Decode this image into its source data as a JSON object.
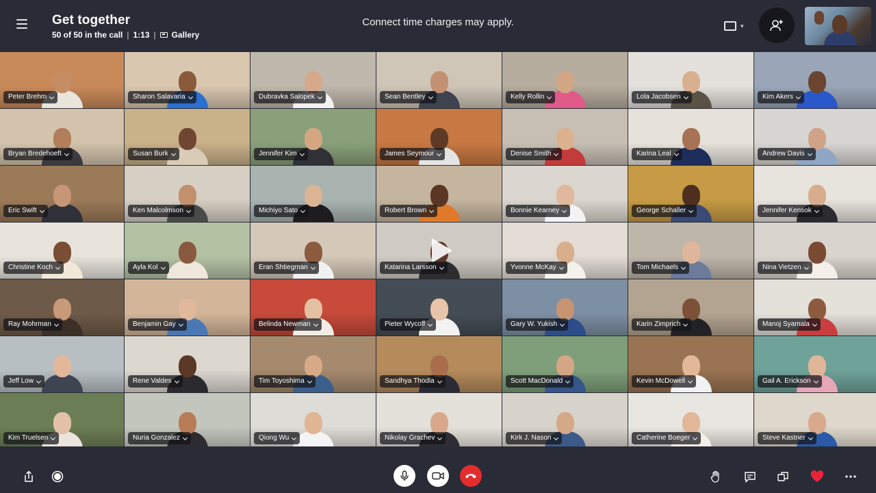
{
  "header": {
    "title": "Get together",
    "participants": "50 of 50 in the call",
    "duration": "1:13",
    "view_mode": "Gallery",
    "notice": "Connect time charges may apply."
  },
  "participants": [
    {
      "name": "Peter Brehm",
      "bg": "#c98a5a",
      "skin": "#c58d63",
      "shirt": "#e9e4dc"
    },
    {
      "name": "Sharon Salavaria",
      "bg": "#d9c7b0",
      "skin": "#8a5a3c",
      "shirt": "#2b6fd1"
    },
    {
      "name": "Dubravka Salopek",
      "bg": "#bfb8ad",
      "skin": "#d6a98a",
      "shirt": "#f1f1f1"
    },
    {
      "name": "Sean Bentley",
      "bg": "#cfc6b8",
      "skin": "#c39073",
      "shirt": "#3f4350"
    },
    {
      "name": "Kelly Rollin",
      "bg": "#b7ad9e",
      "skin": "#d2a684",
      "shirt": "#e05a8a"
    },
    {
      "name": "Lola Jacobsen",
      "bg": "#e4e1dc",
      "skin": "#d9b08f",
      "shirt": "#5b5247"
    },
    {
      "name": "Kim Akers",
      "bg": "#9aa6b8",
      "skin": "#6b4530",
      "shirt": "#2a57c9"
    },
    {
      "name": "Bryan Bredehoeft",
      "bg": "#d3c3ad",
      "skin": "#b17d5a",
      "shirt": "#3b3b3f"
    },
    {
      "name": "Susan Burk",
      "bg": "#c9b189",
      "skin": "#6e4631",
      "shirt": "#d9cbb5"
    },
    {
      "name": "Jennifer Kim",
      "bg": "#8aa07a",
      "skin": "#d4a782",
      "shirt": "#2f3136"
    },
    {
      "name": "James Seymour",
      "bg": "#c87842",
      "skin": "#5e3a26",
      "shirt": "#e4e4e4"
    },
    {
      "name": "Denise Smith",
      "bg": "#c7bfb4",
      "skin": "#dcb18d",
      "shirt": "#c33b3b"
    },
    {
      "name": "Karina Leal",
      "bg": "#e6e2da",
      "skin": "#a87254",
      "shirt": "#1e2e5a"
    },
    {
      "name": "Andrew Davis",
      "bg": "#d8d6d2",
      "skin": "#d0a287",
      "shirt": "#8fa6c4"
    },
    {
      "name": "Eric Swift",
      "bg": "#9b7a58",
      "skin": "#c79676",
      "shirt": "#2f3038"
    },
    {
      "name": "Ken Malcolmson",
      "bg": "#d6cfc4",
      "skin": "#c2906c",
      "shirt": "#4a4a4a"
    },
    {
      "name": "Michiyo Sato",
      "bg": "#a9b4b1",
      "skin": "#dbb493",
      "shirt": "#1d1d20"
    },
    {
      "name": "Robert Brown",
      "bg": "#c6b59e",
      "skin": "#5a3725",
      "shirt": "#e07a2a"
    },
    {
      "name": "Bonnie Kearney",
      "bg": "#dbd6cf",
      "skin": "#e0b99c",
      "shirt": "#f3f3f3"
    },
    {
      "name": "George Schaller",
      "bg": "#c79b45",
      "skin": "#4e2e1e",
      "shirt": "#3a4a77"
    },
    {
      "name": "Jennifer Kensok",
      "bg": "#e7e3dd",
      "skin": "#d8ad8d",
      "shirt": "#2c2c30"
    },
    {
      "name": "Christine Koch",
      "bg": "#e8e4dc",
      "skin": "#7a4e35",
      "shirt": "#f2e8d8"
    },
    {
      "name": "Ayla Kol",
      "bg": "#b4c2a4",
      "skin": "#8a5a40",
      "shirt": "#f0e7dc"
    },
    {
      "name": "Eran Shtiegman",
      "bg": "#d4c8b8",
      "skin": "#8c5b3f",
      "shirt": "#f1f1f1"
    },
    {
      "name": "Katarina Larsson",
      "bg": "#cfcac3",
      "skin": "#5c3a28",
      "shirt": "#2d2d30"
    },
    {
      "name": "Yvonne McKay",
      "bg": "#e2dcd4",
      "skin": "#d8ae8b",
      "shirt": "#f5f2ec"
    },
    {
      "name": "Tom Michaels",
      "bg": "#bfb6aa",
      "skin": "#e0b69a",
      "shirt": "#6c7b9b"
    },
    {
      "name": "Nina Vietzen",
      "bg": "#d9d4cd",
      "skin": "#7a4a33",
      "shirt": "#f4efe8"
    },
    {
      "name": "Ray Mohrman",
      "bg": "#6e5a48",
      "skin": "#c99a77",
      "shirt": "#3b2f28"
    },
    {
      "name": "Benjamin Gay",
      "bg": "#d3b599",
      "skin": "#e1b899",
      "shirt": "#4a78b5"
    },
    {
      "name": "Belinda Newman",
      "bg": "#c74a3a",
      "skin": "#e4c0a3",
      "shirt": "#f1ede6"
    },
    {
      "name": "Pieter Wycoff",
      "bg": "#444d56",
      "skin": "#e8c4a8",
      "shirt": "#f2f2f2"
    },
    {
      "name": "Gary W. Yukish",
      "bg": "#7d8fa3",
      "skin": "#c79472",
      "shirt": "#2c4d8a"
    },
    {
      "name": "Karin Zimprich",
      "bg": "#b3a491",
      "skin": "#7d5038",
      "shirt": "#222226"
    },
    {
      "name": "Manoj Syamala",
      "bg": "#e4e0da",
      "skin": "#8c5a3c",
      "shirt": "#c93e3e"
    },
    {
      "name": "Jeff Low",
      "bg": "#b8bfc2",
      "skin": "#e2b79a",
      "shirt": "#3e4552"
    },
    {
      "name": "Rene Valdes",
      "bg": "#dcd8d0",
      "skin": "#5c3826",
      "shirt": "#2b2b2f"
    },
    {
      "name": "Tim Toyoshima",
      "bg": "#a58a6e",
      "skin": "#d6aa86",
      "shirt": "#3a5f8a"
    },
    {
      "name": "Sandhya Thodla",
      "bg": "#b58b5c",
      "skin": "#a86d4d",
      "shirt": "#2b2b33"
    },
    {
      "name": "Scott MacDonald",
      "bg": "#7f9f7a",
      "skin": "#d5a686",
      "shirt": "#35568a"
    },
    {
      "name": "Kevin McDowell",
      "bg": "#9a7452",
      "skin": "#e3b898",
      "shirt": "#f2f2f2"
    },
    {
      "name": "Gail A. Erickson",
      "bg": "#6fa39a",
      "skin": "#e0b699",
      "shirt": "#e6a6b6"
    },
    {
      "name": "Kim Truelsen",
      "bg": "#6b7d55",
      "skin": "#e4c1a6",
      "shirt": "#e9e4dc"
    },
    {
      "name": "Nuria Gonzalez",
      "bg": "#c3c6bd",
      "skin": "#b77b56",
      "shirt": "#2c2c30"
    },
    {
      "name": "Qiong Wu",
      "bg": "#dedcd6",
      "skin": "#e0b594",
      "shirt": "#f4f4f4"
    },
    {
      "name": "Nikolay Grachev",
      "bg": "#e4e0da",
      "skin": "#d9a88b",
      "shirt": "#2d2d33"
    },
    {
      "name": "Kirk J. Nason",
      "bg": "#d8d3ca",
      "skin": "#d5a887",
      "shirt": "#3b5a8a"
    },
    {
      "name": "Catherine Boeger",
      "bg": "#e8e6e1",
      "skin": "#e1b798",
      "shirt": "#f2eee8"
    },
    {
      "name": "Steve Kastner",
      "bg": "#ded7cb",
      "skin": "#d8a98a",
      "shirt": "#2a5aa8"
    }
  ],
  "icons": {
    "menu": "hamburger-icon",
    "view_switch": "frame-icon",
    "add_people": "add-person-icon",
    "share": "share-icon",
    "record": "record-icon",
    "mic": "microphone-icon",
    "video": "video-camera-icon",
    "hangup": "hang-up-icon",
    "raise_hand": "raise-hand-icon",
    "chat": "chat-icon",
    "more_options": "switch-window-icon",
    "react": "heart-icon",
    "more": "more-icon"
  },
  "colors": {
    "bar_background": "#292b36",
    "hangup": "#e32d2d",
    "heart": "#e8243a"
  }
}
